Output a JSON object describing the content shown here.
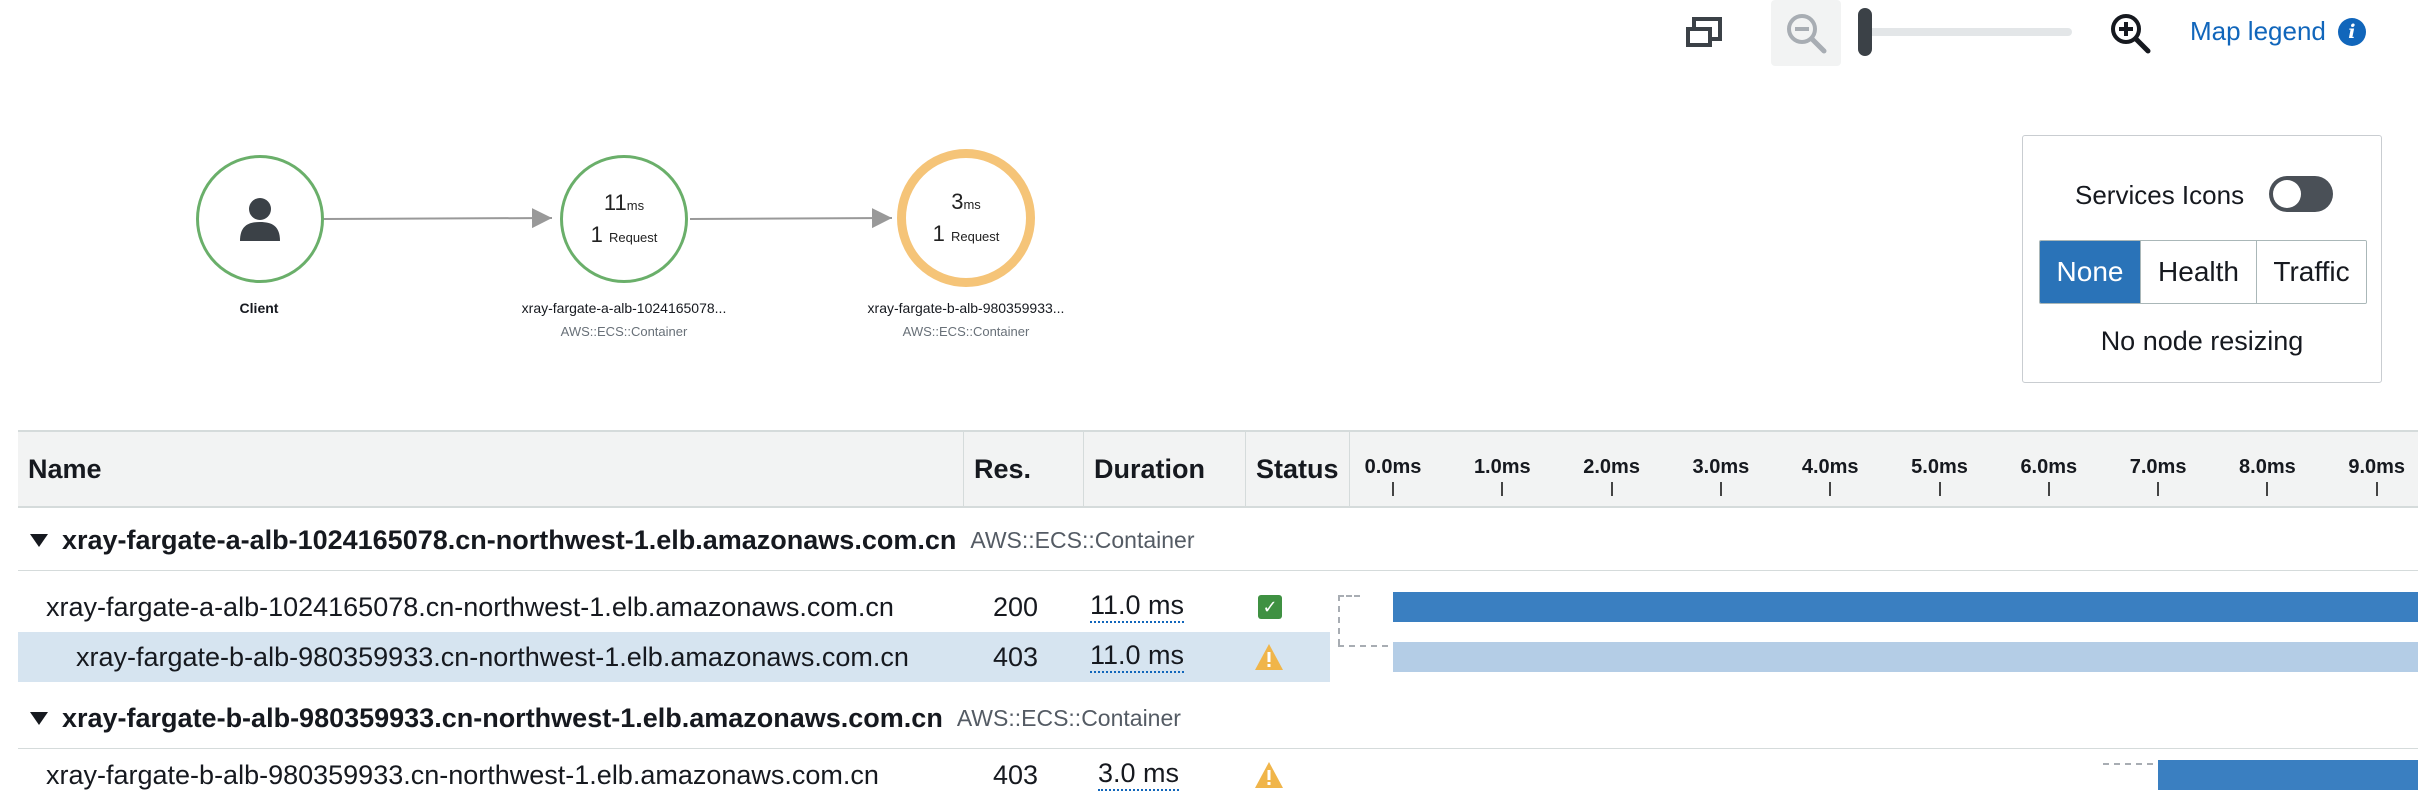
{
  "toolbar": {
    "fit_icon": "fit-view-icon",
    "zoom_out_icon": "zoom-out-icon",
    "zoom_in_icon": "zoom-in-icon",
    "zoom_level": 0,
    "map_legend_label": "Map legend",
    "info_icon": "info-icon"
  },
  "map": {
    "nodes": [
      {
        "id": "client",
        "label": "Client",
        "sublabel": "",
        "icon": "user-icon",
        "health": "ok"
      },
      {
        "id": "svc-a",
        "duration_value": "11",
        "duration_unit": "ms",
        "requests_value": "1",
        "requests_unit": "Request",
        "label": "xray-fargate-a-alb-1024165078...",
        "sublabel": "AWS::ECS::Container",
        "health": "ok"
      },
      {
        "id": "svc-b",
        "duration_value": "3",
        "duration_unit": "ms",
        "requests_value": "1",
        "requests_unit": "Request",
        "label": "xray-fargate-b-alb-980359933...",
        "sublabel": "AWS::ECS::Container",
        "health": "error"
      }
    ],
    "colors": {
      "ok": "#6aaf6a",
      "error": "#f5c478",
      "edge": "#999999"
    }
  },
  "legend_panel": {
    "services_icons_label": "Services Icons",
    "services_icons_on": false,
    "mode_options": [
      "None",
      "Health",
      "Traffic"
    ],
    "mode_selected": "None",
    "resize_text": "No node resizing"
  },
  "table": {
    "headers": {
      "name": "Name",
      "res": "Res.",
      "duration": "Duration",
      "status": "Status"
    },
    "timeline_ticks": [
      "0.0ms",
      "1.0ms",
      "2.0ms",
      "3.0ms",
      "4.0ms",
      "5.0ms",
      "6.0ms",
      "7.0ms",
      "8.0ms",
      "9.0ms"
    ],
    "groups": [
      {
        "name": "xray-fargate-a-alb-1024165078.cn-northwest-1.elb.amazonaws.com.cn",
        "type": "AWS::ECS::Container",
        "rows": [
          {
            "name": "xray-fargate-a-alb-1024165078.cn-northwest-1.elb.amazonaws.com.cn",
            "res": "200",
            "duration": "11.0 ms",
            "status": "ok",
            "start_ms": 0.0,
            "end_ms": 11.0,
            "selected": false,
            "indent": 0
          },
          {
            "name": "xray-fargate-b-alb-980359933.cn-northwest-1.elb.amazonaws.com.cn",
            "res": "403",
            "duration": "11.0 ms",
            "status": "warning",
            "start_ms": 0.0,
            "end_ms": 11.0,
            "selected": true,
            "indent": 1
          }
        ]
      },
      {
        "name": "xray-fargate-b-alb-980359933.cn-northwest-1.elb.amazonaws.com.cn",
        "type": "AWS::ECS::Container",
        "rows": [
          {
            "name": "xray-fargate-b-alb-980359933.cn-northwest-1.elb.amazonaws.com.cn",
            "res": "403",
            "duration": "3.0 ms",
            "status": "warning",
            "start_ms": 7.0,
            "end_ms": 11.0,
            "selected": false,
            "indent": 0
          }
        ]
      }
    ],
    "colors": {
      "bar_primary": "#3a7fc1",
      "bar_selected": "#b4cde6",
      "ok": "#3f9142",
      "warning": "#f0b54a"
    }
  }
}
